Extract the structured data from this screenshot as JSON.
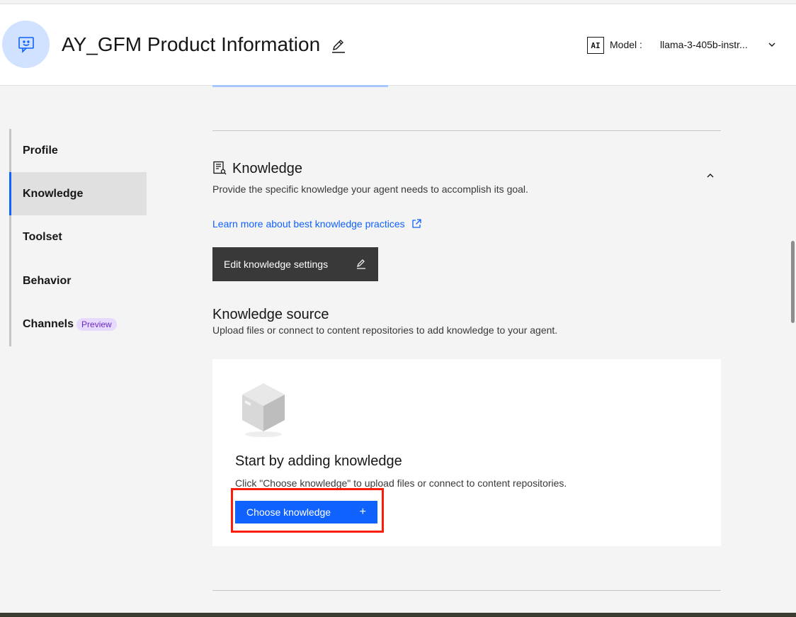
{
  "header": {
    "title": "AY_GFM Product Information",
    "model_badge": "AI",
    "model_label": "Model :",
    "model_value": "llama-3-405b-instr..."
  },
  "sidenav": {
    "items": [
      {
        "label": "Profile"
      },
      {
        "label": "Knowledge",
        "active": true
      },
      {
        "label": "Toolset"
      },
      {
        "label": "Behavior"
      },
      {
        "label": "Channels",
        "tag": "Preview"
      }
    ]
  },
  "knowledge": {
    "title": "Knowledge",
    "description": "Provide the specific knowledge your agent needs to accomplish its goal.",
    "learn_link": "Learn more about best knowledge practices",
    "edit_button": "Edit knowledge settings"
  },
  "source": {
    "title": "Knowledge source",
    "description": "Upload files or connect to content repositories to add knowledge to your agent."
  },
  "empty_state": {
    "title": "Start by adding knowledge",
    "description": "Click \"Choose knowledge\" to upload files or connect to content repositories.",
    "button": "Choose knowledge",
    "button_icon": "+"
  },
  "colors": {
    "primary": "#0f62fe",
    "highlight": "#fa1e0a",
    "dark_button": "#393939",
    "preview_tag_bg": "#e8daff",
    "preview_tag_fg": "#6929c4"
  }
}
